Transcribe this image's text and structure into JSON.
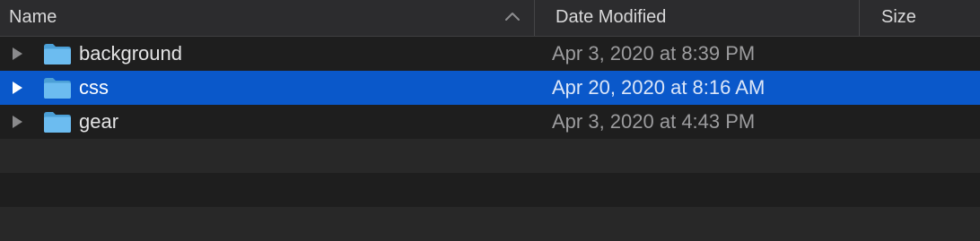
{
  "header": {
    "name_label": "Name",
    "date_label": "Date Modified",
    "size_label": "Size",
    "sort_icon": "chevron-up-icon"
  },
  "colors": {
    "selection": "#0a58ca",
    "folder": "#5fb2e6",
    "header_bg": "#2c2c2e",
    "row_alt": "#282828"
  },
  "files": [
    {
      "name": "background",
      "modified": "Apr 3, 2020 at 8:39 PM",
      "size": "",
      "icon": "folder-icon",
      "selected": false
    },
    {
      "name": "css",
      "modified": "Apr 20, 2020 at 8:16 AM",
      "size": "",
      "icon": "folder-icon",
      "selected": true
    },
    {
      "name": "gear",
      "modified": "Apr 3, 2020 at 4:43 PM",
      "size": "",
      "icon": "folder-icon",
      "selected": false
    }
  ],
  "empty_rows": 2
}
